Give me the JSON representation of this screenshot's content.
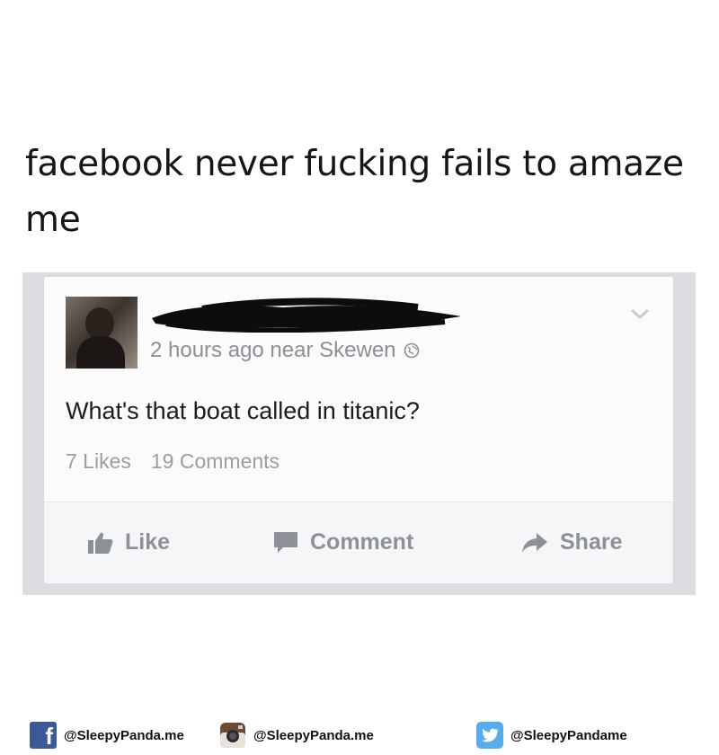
{
  "meme": {
    "caption": "facebook never fucking fails to amaze me"
  },
  "post": {
    "author_name": "",
    "meta": "2 hours ago near Skewen",
    "text": "What's that boat called in titanic?",
    "likes": "7 Likes",
    "comments": "19 Comments",
    "actions": {
      "like": "Like",
      "comment": "Comment",
      "share": "Share"
    }
  },
  "footer": {
    "facebook": "@SleepyPanda.me",
    "instagram": "@SleepyPanda.me",
    "twitter": "@SleepyPandame"
  },
  "colors": {
    "facebook_blue": "#3b5998",
    "twitter_blue": "#55acee",
    "muted_text": "#8d9096",
    "frame_gray": "#dcdde2"
  },
  "icons": [
    "avatar",
    "globe-icon",
    "chevron-down-icon",
    "thumbs-up-icon",
    "comment-icon",
    "share-arrow-icon",
    "facebook-logo",
    "instagram-logo",
    "twitter-logo"
  ]
}
